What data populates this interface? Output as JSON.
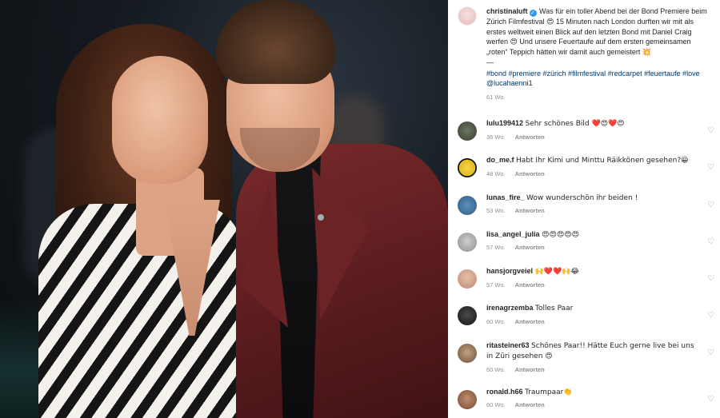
{
  "post": {
    "caption": {
      "username": "christinaluft",
      "text": "Was für ein toller Abend bei der Bond Premiere beim Zürich Filmfestival 😍 15 Minuten nach London durften wir mit als erstes weltweit einen Blick auf den letzten Bond mit Daniel Craig werfen 😍 Und unsere Feuertaufe auf dem ersten gemeinsamen „roten“ Teppich hätten wir damit auch gemeistert 💥",
      "dash": "—",
      "hashtags": "#bond #premiere #zürich #filmfestival #redcarpet #feuertaufe #love @lucahaenni1",
      "age": "61 Wo."
    },
    "reply_label": "Antworten",
    "comments": [
      {
        "username": "lulu199412",
        "text": "Sehr schönes Bild ❤️😍❤️😍",
        "age": "36 Wo.",
        "avatar_icon": "user-avatar"
      },
      {
        "username": "do_me.f",
        "text": "Habt Ihr Kimi und Minttu Räikkönen gesehen?😀",
        "age": "48 Wo.",
        "avatar_icon": "user-avatar"
      },
      {
        "username": "lunas_fire_",
        "text": "Wow wunderschön ihr beiden !",
        "age": "53 Wo.",
        "avatar_icon": "user-avatar"
      },
      {
        "username": "lisa_angel_julia",
        "text": "😍😍😍😍😍",
        "age": "57 Wo.",
        "avatar_icon": "user-avatar"
      },
      {
        "username": "hansjorgveiel",
        "text": "🙌❤️❤️🙌😂",
        "age": "57 Wo.",
        "avatar_icon": "user-avatar"
      },
      {
        "username": "irenagrzemba",
        "text": "Tolles Paar",
        "age": "60 Wo.",
        "avatar_icon": "user-avatar"
      },
      {
        "username": "ritasteiner63",
        "text": "Schönes Paar!! Hätte Euch gerne live bei uns in Züri gesehen 😍",
        "age": "60 Wo.",
        "avatar_icon": "user-avatar"
      },
      {
        "username": "ronald.h66",
        "text": "Traumpaar👏",
        "age": "60 Wo.",
        "avatar_icon": "user-avatar"
      }
    ]
  },
  "icons": {
    "like": "heart-outline-icon",
    "verified": "verified-badge-icon"
  },
  "colors": {
    "link": "#00376b",
    "muted": "#8e8e8e",
    "verified": "#3897f0",
    "text": "#262626"
  }
}
